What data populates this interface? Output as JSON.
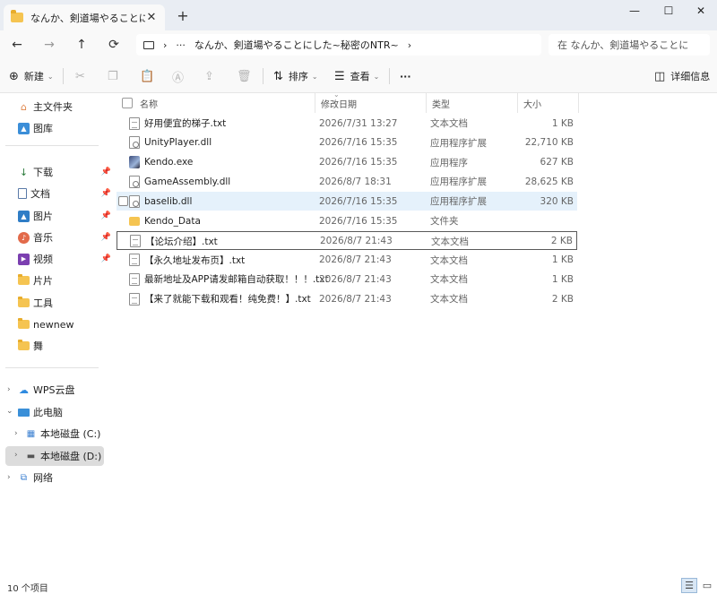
{
  "window": {
    "tab_title": "なんか、剣道場やることにし,",
    "tab_close": "✕",
    "new_tab": "+",
    "controls": {
      "minimize": "—",
      "maximize": "☐",
      "close": "✕"
    }
  },
  "nav": {
    "back": "←",
    "forward": "→",
    "up": "↑",
    "refresh": "⟳"
  },
  "address": {
    "chevron1": "›",
    "ellipsis": "···",
    "path": "なんか、剣道場やることにした~秘密のNTR~",
    "chevron2": "›"
  },
  "search": {
    "placeholder": "在 なんか、剣道場やることに"
  },
  "toolbar": {
    "new_label": "新建",
    "sort_label": "排序",
    "view_label": "查看",
    "more_label": "···",
    "details_label": "详细信息"
  },
  "sidebar": {
    "home": "主文件夹",
    "gallery": "图库",
    "quick": [
      "下载",
      "文档",
      "图片",
      "音乐",
      "视频",
      "片片",
      "工具",
      "newnew",
      "舞"
    ],
    "wps": "WPS云盘",
    "thispc": "此电脑",
    "disk_c": "本地磁盘 (C:)",
    "disk_d": "本地磁盘 (D:)",
    "network": "网络"
  },
  "columns": {
    "name": "名称",
    "date": "修改日期",
    "type": "类型",
    "size": "大小"
  },
  "files": [
    {
      "name": "好用便宜的梯子.txt",
      "date": "2026/7/31 13:27",
      "type": "文本文档",
      "size": "1 KB",
      "icon": "doc"
    },
    {
      "name": "UnityPlayer.dll",
      "date": "2026/7/16 15:35",
      "type": "应用程序扩展",
      "size": "22,710 KB",
      "icon": "dll"
    },
    {
      "name": "Kendo.exe",
      "date": "2026/7/16 15:35",
      "type": "应用程序",
      "size": "627 KB",
      "icon": "exe"
    },
    {
      "name": "GameAssembly.dll",
      "date": "2026/8/7 18:31",
      "type": "应用程序扩展",
      "size": "28,625 KB",
      "icon": "dll"
    },
    {
      "name": "baselib.dll",
      "date": "2026/7/16 15:35",
      "type": "应用程序扩展",
      "size": "320 KB",
      "icon": "dll"
    },
    {
      "name": "Kendo_Data",
      "date": "2026/7/16 15:35",
      "type": "文件夹",
      "size": "",
      "icon": "folder"
    },
    {
      "name": "【论坛介绍】.txt",
      "date": "2026/8/7 21:43",
      "type": "文本文档",
      "size": "2 KB",
      "icon": "doc"
    },
    {
      "name": "【永久地址发布页】.txt",
      "date": "2026/8/7 21:43",
      "type": "文本文档",
      "size": "1 KB",
      "icon": "doc"
    },
    {
      "name": "最新地址及APP请发邮箱自动获取！！！.txt",
      "date": "2026/8/7 21:43",
      "type": "文本文档",
      "size": "1 KB",
      "icon": "doc"
    },
    {
      "name": "【来了就能下载和观看！纯免费！】.txt",
      "date": "2026/8/7 21:43",
      "type": "文本文档",
      "size": "2 KB",
      "icon": "doc"
    }
  ],
  "status": {
    "count": "10 个项目"
  },
  "colors": {
    "hover_row": "#e5f1fb",
    "selected_sidebar": "#dcdcdc",
    "folder": "#f5c451"
  }
}
